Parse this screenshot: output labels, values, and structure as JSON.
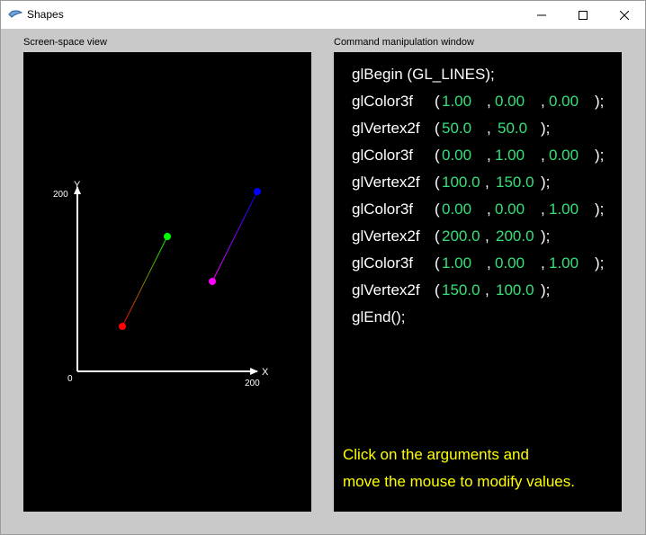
{
  "window": {
    "title": "Shapes",
    "buttons": [
      "minimize",
      "maximize",
      "close"
    ]
  },
  "left_panel": {
    "label": "Screen-space view",
    "axes": {
      "y_label": "Y",
      "y_max_label": "200",
      "x_label": "X",
      "x_max_label": "200",
      "origin_label": "0"
    },
    "vertices": [
      {
        "x": 50.0,
        "y": 50.0,
        "color": "#ff0000"
      },
      {
        "x": 100.0,
        "y": 150.0,
        "color": "#00ff00"
      },
      {
        "x": 200.0,
        "y": 200.0,
        "color": "#0000ff"
      },
      {
        "x": 150.0,
        "y": 100.0,
        "color": "#ff00ff"
      }
    ]
  },
  "right_panel": {
    "label": "Command manipulation window",
    "code": {
      "begin": "glBegin (GL_LINES);",
      "end": "glEnd();",
      "color_fn": "glColor3f",
      "vertex_fn": "glVertex2f",
      "lines": [
        {
          "type": "color",
          "args": [
            "1.00",
            "0.00",
            "0.00"
          ]
        },
        {
          "type": "vertex",
          "args": [
            "50.0",
            "50.0"
          ]
        },
        {
          "type": "color",
          "args": [
            "0.00",
            "1.00",
            "0.00"
          ]
        },
        {
          "type": "vertex",
          "args": [
            "100.0",
            "150.0"
          ]
        },
        {
          "type": "color",
          "args": [
            "0.00",
            "0.00",
            "1.00"
          ]
        },
        {
          "type": "vertex",
          "args": [
            "200.0",
            "200.0"
          ]
        },
        {
          "type": "color",
          "args": [
            "1.00",
            "0.00",
            "1.00"
          ]
        },
        {
          "type": "vertex",
          "args": [
            "150.0",
            "100.0"
          ]
        }
      ]
    },
    "hint_line1": "Click on the arguments and",
    "hint_line2": "move the mouse to modify values."
  }
}
